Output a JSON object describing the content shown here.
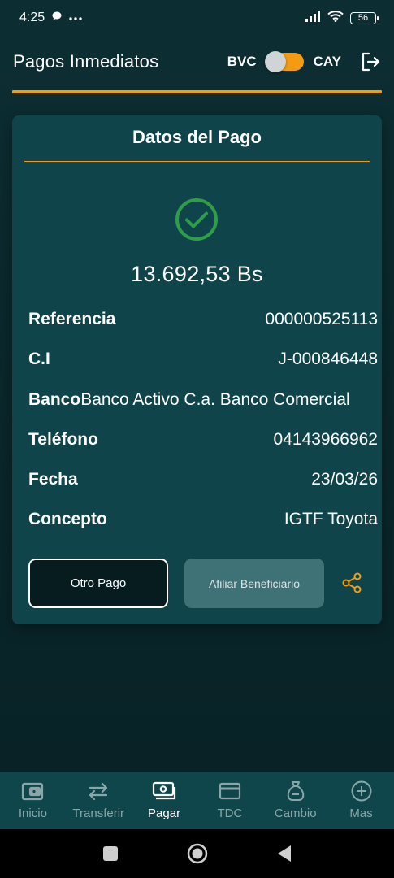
{
  "status_bar": {
    "time": "4:25",
    "battery": "56"
  },
  "header": {
    "title": "Pagos Inmediatos",
    "bank_left": "BVC",
    "bank_right": "CAY"
  },
  "card": {
    "title": "Datos del Pago",
    "amount": "13.692,53 Bs",
    "details": [
      {
        "label": "Referencia",
        "value": "000000525113"
      },
      {
        "label": "C.I",
        "value": "J-000846448"
      },
      {
        "label": "Banco",
        "value": "Banco Activo C.a. Banco Comercial"
      },
      {
        "label": "Teléfono",
        "value": "04143966962"
      },
      {
        "label": "Fecha",
        "value": "23/03/26"
      },
      {
        "label": "Concepto",
        "value": "IGTF Toyota"
      }
    ],
    "btn_otro": "Otro Pago",
    "btn_afiliar": "Afiliar Beneficiario"
  },
  "nav": {
    "items": [
      {
        "label": "Inicio",
        "icon": "wallet-icon"
      },
      {
        "label": "Transferir",
        "icon": "transfer-icon"
      },
      {
        "label": "Pagar",
        "icon": "pay-icon",
        "active": true
      },
      {
        "label": "TDC",
        "icon": "credit-card-icon"
      },
      {
        "label": "Cambio",
        "icon": "money-bag-icon"
      },
      {
        "label": "Mas",
        "icon": "plus-circle-icon"
      }
    ]
  },
  "colors": {
    "accent": "#f39c12",
    "background": "#0c2e33",
    "card": "#0f454a",
    "success": "#2e9e48",
    "nav_background": "#0e464c"
  }
}
